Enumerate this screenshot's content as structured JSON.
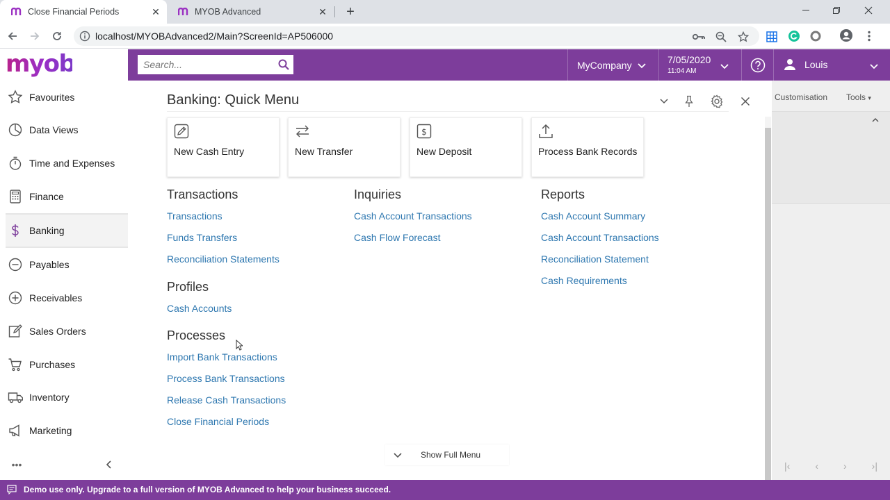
{
  "browser": {
    "tabs": [
      {
        "title": "Close Financial Periods",
        "active": true
      },
      {
        "title": "MYOB Advanced",
        "active": false
      }
    ],
    "url": "localhost/MYOBAdvanced2/Main?ScreenId=AP506000"
  },
  "header": {
    "logo": "myob",
    "search_placeholder": "Search...",
    "company": "MyCompany",
    "date": "7/05/2020",
    "time": "11:04 AM",
    "user": "Louis"
  },
  "sidebar": {
    "items": [
      {
        "label": "Favourites",
        "icon": "star-icon"
      },
      {
        "label": "Data Views",
        "icon": "pie-chart-icon"
      },
      {
        "label": "Time and Expenses",
        "icon": "stopwatch-icon"
      },
      {
        "label": "Finance",
        "icon": "calculator-icon"
      },
      {
        "label": "Banking",
        "icon": "dollar-icon"
      },
      {
        "label": "Payables",
        "icon": "minus-circle-icon"
      },
      {
        "label": "Receivables",
        "icon": "plus-circle-icon"
      },
      {
        "label": "Sales Orders",
        "icon": "edit-icon"
      },
      {
        "label": "Purchases",
        "icon": "cart-icon"
      },
      {
        "label": "Inventory",
        "icon": "truck-icon"
      },
      {
        "label": "Marketing",
        "icon": "megaphone-icon"
      }
    ],
    "active": "Banking",
    "more": "•••"
  },
  "background": {
    "customisation": "Customisation",
    "tools": "Tools"
  },
  "quick_menu": {
    "title": "Banking: Quick Menu",
    "quick_actions": [
      {
        "label": "New Cash Entry",
        "icon": "pencil-square-icon"
      },
      {
        "label": "New Transfer",
        "icon": "transfer-arrows-icon"
      },
      {
        "label": "New Deposit",
        "icon": "dollar-box-icon"
      },
      {
        "label": "Process Bank Records",
        "icon": "upload-icon"
      }
    ],
    "transactions": {
      "heading": "Transactions",
      "links": [
        "Transactions",
        "Funds Transfers",
        "Reconciliation Statements"
      ]
    },
    "profiles": {
      "heading": "Profiles",
      "links": [
        "Cash Accounts"
      ]
    },
    "processes": {
      "heading": "Processes",
      "links": [
        "Import Bank Transactions",
        "Process Bank Transactions",
        "Release Cash Transactions",
        "Close Financial Periods"
      ]
    },
    "inquiries": {
      "heading": "Inquiries",
      "links": [
        "Cash Account Transactions",
        "Cash Flow Forecast"
      ]
    },
    "reports": {
      "heading": "Reports",
      "links": [
        "Cash Account Summary",
        "Cash Account Transactions",
        "Reconciliation Statement",
        "Cash Requirements"
      ]
    },
    "show_full_menu": "Show Full Menu"
  },
  "footer": {
    "message": "Demo use only. Upgrade to a full version of MYOB Advanced to help your business succeed."
  },
  "colors": {
    "brand_purple": "#7d3d9b",
    "link_blue": "#2f78b0"
  }
}
